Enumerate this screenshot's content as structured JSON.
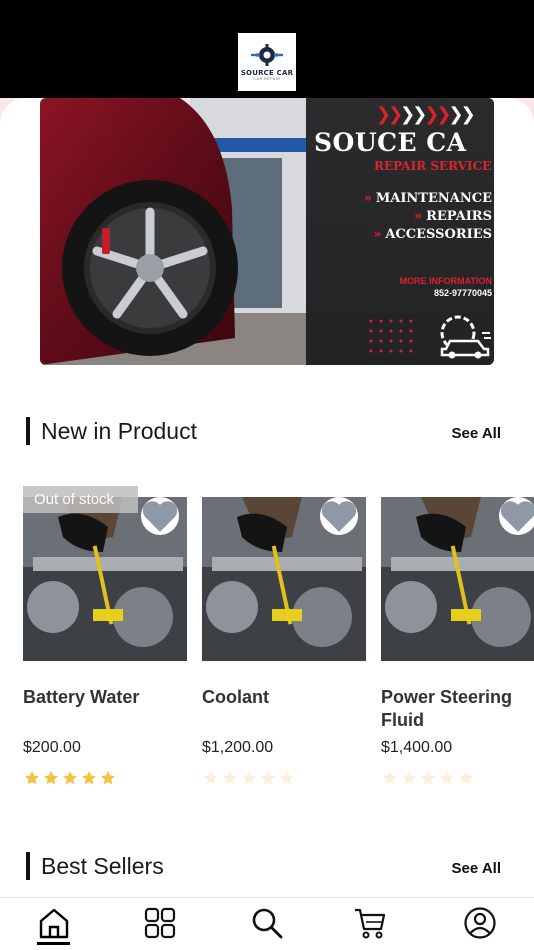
{
  "header": {
    "logo_title": "SOURCE CAR",
    "logo_subtitle": "CAR REPAIR",
    "logo_icon": "gear-wrench-icon"
  },
  "banner": {
    "title": "SOUCE CA",
    "subtitle": "REPAIR SERVICE",
    "services": [
      "MAINTENANCE",
      "REPAIRS",
      "ACCESSORIES"
    ],
    "more_label": "MORE INFORMATION",
    "phone": "852-97770045",
    "accent_color": "#e0202a"
  },
  "new_products": {
    "title": "New in Product",
    "see_all": "See All",
    "items": [
      {
        "name": "Battery Water",
        "price": "$200.00",
        "rating": 5,
        "badge": "Out of stock",
        "favorite_icon": "heart-icon"
      },
      {
        "name": "Coolant",
        "price": "$1,200.00",
        "rating": 0,
        "badge": "",
        "favorite_icon": "heart-icon"
      },
      {
        "name": "Power Steering Fluid",
        "price": "$1,400.00",
        "rating": 0,
        "badge": "",
        "favorite_icon": "heart-icon"
      }
    ]
  },
  "best_sellers": {
    "title": "Best Sellers",
    "see_all": "See All"
  },
  "tabbar": {
    "items": [
      {
        "icon": "home-icon",
        "active": true
      },
      {
        "icon": "grid-icon",
        "active": false
      },
      {
        "icon": "search-icon",
        "active": false
      },
      {
        "icon": "cart-icon",
        "active": false
      },
      {
        "icon": "profile-icon",
        "active": false
      }
    ]
  },
  "colors": {
    "star_filled": "#f5c242",
    "star_empty": "#fbefdc"
  }
}
